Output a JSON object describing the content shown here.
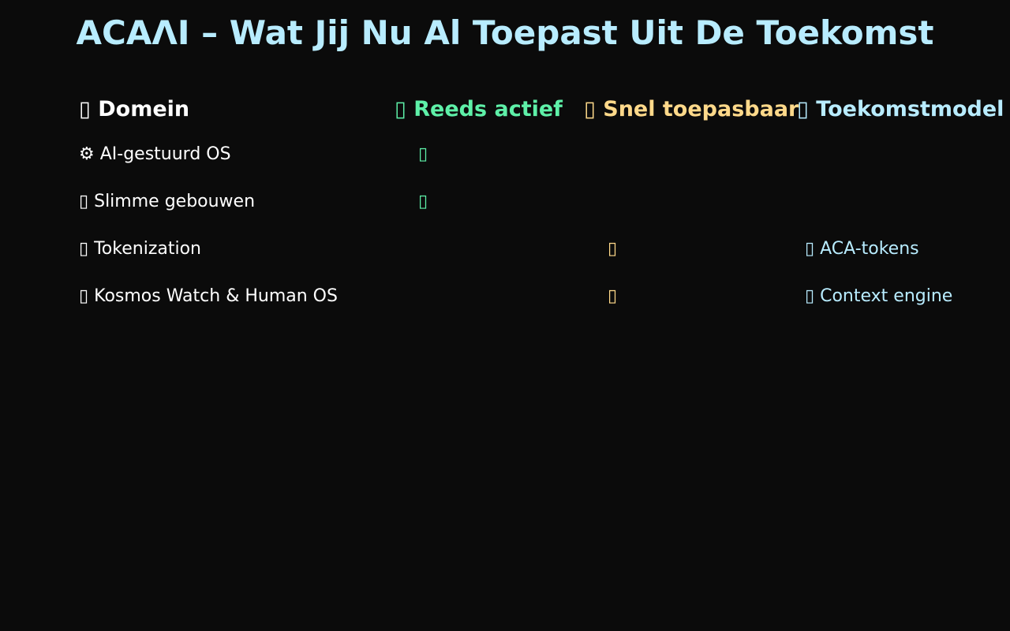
{
  "title": "ACAΛI – Wat Jij Nu Al Toepast Uit De Toekomst",
  "colors": {
    "background": "#0b0b0b",
    "title": "#b8ecff",
    "domain": "#ffffff",
    "active": "#5ef0a8",
    "soon": "#ffd98a",
    "future": "#b8ecff"
  },
  "headers": {
    "domain": {
      "icon": "▯",
      "label": "Domein"
    },
    "active": {
      "icon": "▯",
      "label": "Reeds actief"
    },
    "soon": {
      "icon": "▯",
      "label": "Snel toepasbaar"
    },
    "future": {
      "icon": "▯",
      "label": "Toekomstmodel"
    }
  },
  "rows": [
    {
      "domain_icon": "⚙",
      "domain": "AI-gestuurd OS",
      "active_icon": "▯",
      "soon_icon": "",
      "future_icon": "",
      "future": ""
    },
    {
      "domain_icon": "▯",
      "domain": "Slimme gebouwen",
      "active_icon": "▯",
      "soon_icon": "",
      "future_icon": "",
      "future": ""
    },
    {
      "domain_icon": "▯",
      "domain": "Tokenization",
      "active_icon": "",
      "soon_icon": "▯",
      "future_icon": "▯",
      "future": "ACA-tokens"
    },
    {
      "domain_icon": "▯",
      "domain": "Kosmos Watch & Human OS",
      "active_icon": "",
      "soon_icon": "▯",
      "future_icon": "▯",
      "future": "Context engine"
    }
  ]
}
